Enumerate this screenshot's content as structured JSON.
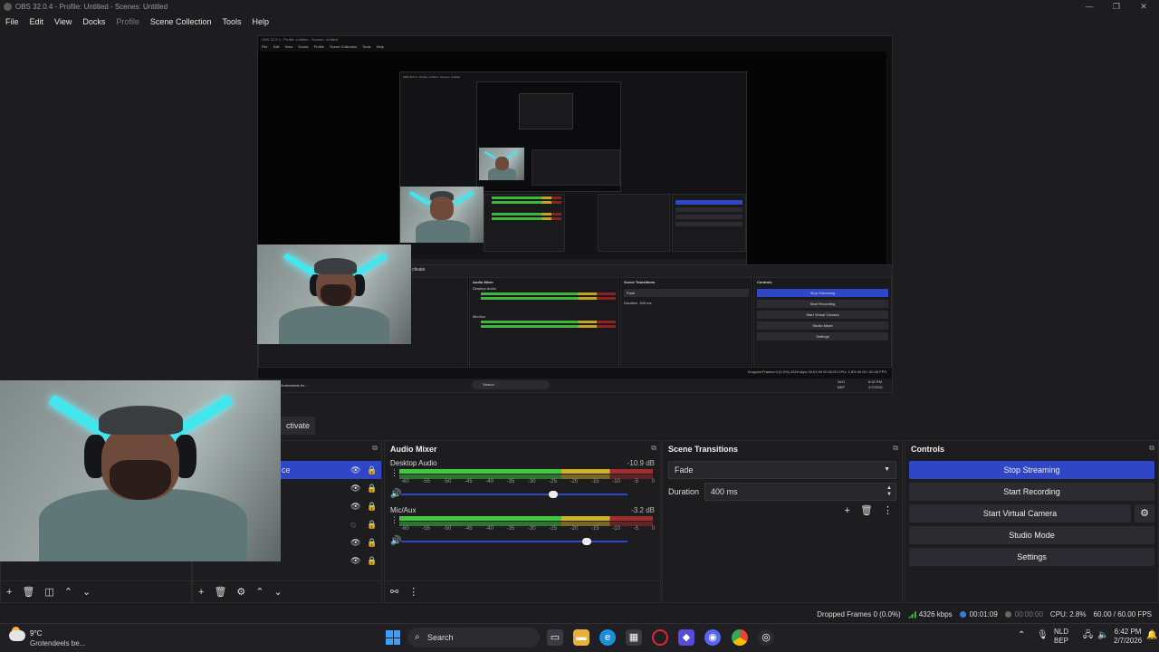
{
  "window": {
    "title": "OBS 32.0.4 - Profile: Untitled - Scenes: Untitled",
    "controls": [
      "—",
      "❐",
      "✕"
    ]
  },
  "menu": [
    {
      "label": "File",
      "disabled": false
    },
    {
      "label": "Edit",
      "disabled": false
    },
    {
      "label": "View",
      "disabled": false
    },
    {
      "label": "Docks",
      "disabled": false
    },
    {
      "label": "Profile",
      "disabled": true
    },
    {
      "label": "Scene Collection",
      "disabled": false
    },
    {
      "label": "Tools",
      "disabled": false
    },
    {
      "label": "Help",
      "disabled": false
    }
  ],
  "dock_tab": {
    "label": "ctivate"
  },
  "sources": {
    "selected_label": "ce",
    "footer_icons": [
      "plus-icon",
      "trash-icon",
      "filter-icon",
      "up-icon",
      "down-icon"
    ]
  },
  "scene_footer_icons": [
    "plus-icon",
    "trash-icon",
    "gear-icon",
    "up-icon",
    "down-icon"
  ],
  "audio_mixer": {
    "title": "Audio Mixer",
    "channels": [
      {
        "name": "Desktop Audio",
        "db": "-10.9 dB",
        "volume": 0.67
      },
      {
        "name": "Mic/Aux",
        "db": "-3.2 dB",
        "volume": 0.82
      }
    ],
    "ticks": [
      "-60",
      "-55",
      "-50",
      "-45",
      "-40",
      "-35",
      "-30",
      "-25",
      "-20",
      "-15",
      "-10",
      "-5",
      "0"
    ]
  },
  "scene_transitions": {
    "title": "Scene Transitions",
    "transition": "Fade",
    "duration_label": "Duration",
    "duration_value": "400 ms"
  },
  "controls": {
    "title": "Controls",
    "stop_streaming": "Stop Streaming",
    "start_recording": "Start Recording",
    "start_virtual_camera": "Start Virtual Camera",
    "studio_mode": "Studio Mode",
    "settings": "Settings"
  },
  "status": {
    "dropped_frames": "Dropped Frames 0 (0.0%)",
    "bitrate": "4326 kbps",
    "stream_time": "00:01:09",
    "record_time": "00:00:00",
    "cpu": "CPU: 2.8%",
    "fps": "60.00 / 60.00 FPS"
  },
  "nested": {
    "title": "OBS 32.0.4 - Profile: Untitled - Scenes: Untitled",
    "menu": [
      "File",
      "Edit",
      "View",
      "Docks",
      "Profile",
      "Scene Collection",
      "Tools",
      "Help"
    ],
    "audio_title": "Audio Mixer",
    "desktop_audio": "Desktop Audio",
    "desktop_db": "-10.9 dB",
    "mic": "Mic/Aux",
    "mic_db": "-3.2 dB",
    "transitions_title": "Scene Transitions",
    "fade": "Fade",
    "duration": "Duration",
    "duration_value": "400 ms",
    "controls_title": "Controls",
    "btns": [
      "Stop Streaming",
      "Start Recording",
      "Start Virtual Camera",
      "Studio Mode",
      "Settings"
    ],
    "activate": "ctivate",
    "status": "Dropped Frames 0 (0.0%)   4326 kbps   00:01:09   00:00:00   CPU: 2.8%   60.00 / 60.00 FPS",
    "taskbar_search": "Search",
    "weather": "Grotendeels be...",
    "clock_time": "6:42 PM",
    "clock_date": "2/7/2026",
    "lang": "NLD",
    "lang2": "BEP"
  },
  "taskbar": {
    "weather_temp": "9°C",
    "weather_desc": "Grotendeels be...",
    "search": "Search",
    "lang": "NLD",
    "lang2": "BEP",
    "time": "6:42 PM",
    "date": "2/7/2026",
    "accent": "#2f47c7"
  }
}
